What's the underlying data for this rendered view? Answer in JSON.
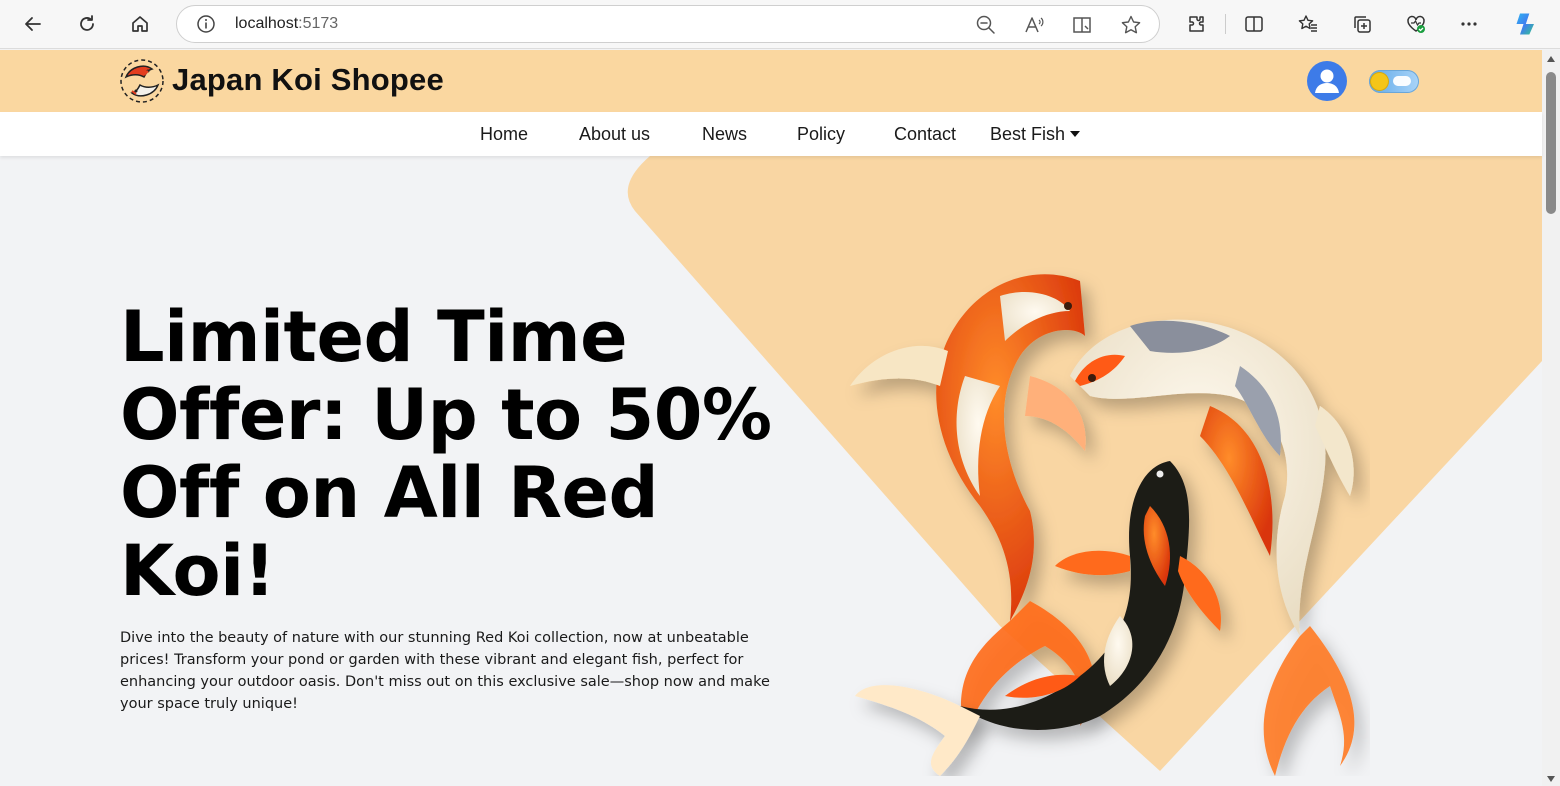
{
  "browser": {
    "url_host": "localhost",
    "url_port": ":5173",
    "icons": [
      "back-arrow-icon",
      "refresh-icon",
      "home-icon",
      "info-icon",
      "zoom-out-icon",
      "read-aloud-icon",
      "immersive-reader-icon",
      "favorite-star-icon",
      "extensions-icon",
      "split-screen-icon",
      "favorites-icon",
      "collections-icon",
      "browser-essentials-icon",
      "more-icon",
      "copilot-icon"
    ]
  },
  "site": {
    "brand": "Japan Koi Shopee",
    "nav": [
      {
        "label": "Home"
      },
      {
        "label": "About us"
      },
      {
        "label": "News"
      },
      {
        "label": "Policy"
      },
      {
        "label": "Contact"
      },
      {
        "label": "Best Fish"
      }
    ]
  },
  "hero": {
    "title": "Limited Time Offer: Up to 50% Off on All Red Koi!",
    "description": "Dive into the beauty of nature with our stunning Red Koi collection, now at unbeatable prices! Transform your pond or garden with these vibrant and elegant fish, perfect for enhancing your outdoor oasis. Don't miss out on this exclusive sale—shop now and make your space truly unique!"
  },
  "colors": {
    "header_bg": "#fad7a0",
    "hero_bg": "#f2f3f5",
    "avatar": "#3d7be8"
  }
}
